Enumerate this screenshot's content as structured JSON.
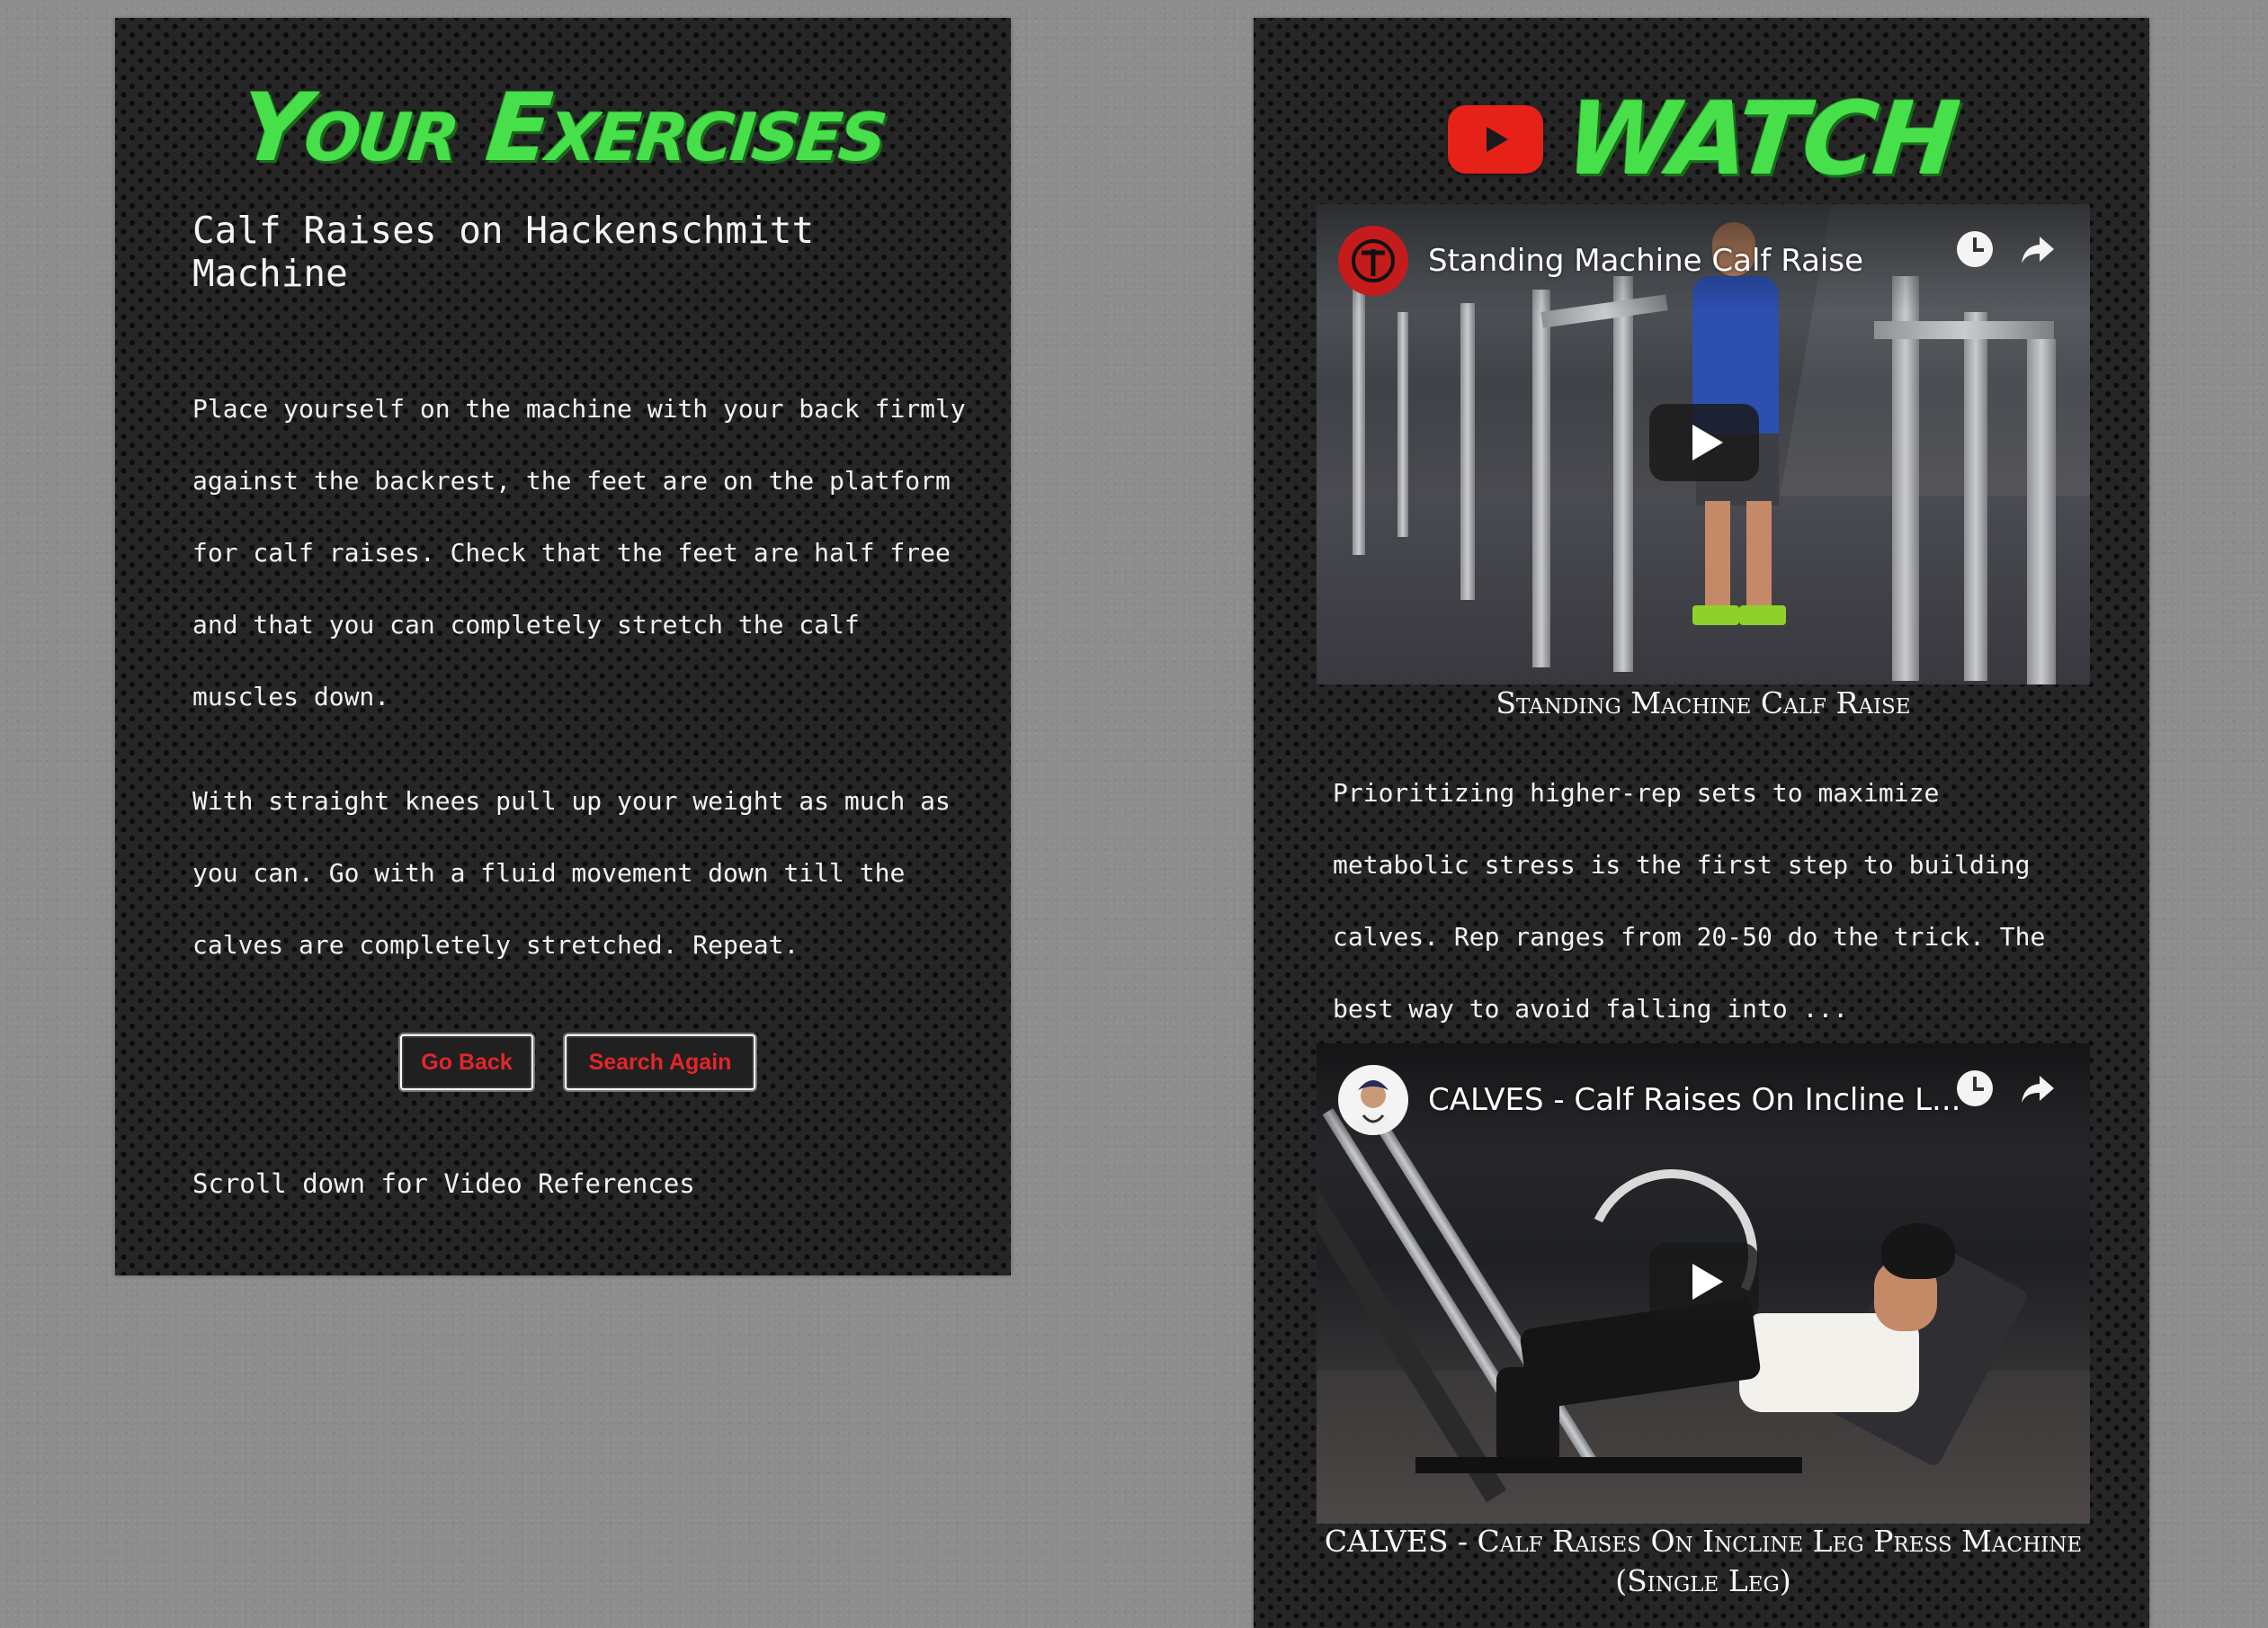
{
  "colors": {
    "title_green": "#47e04a",
    "button_text_red": "#e3262a",
    "youtube_red": "#e62117",
    "panel_background": "#262626"
  },
  "left": {
    "title": "Your Exercises",
    "exercise_name": "Calf Raises on Hackenschmitt Machine",
    "paragraphs": [
      "Place yourself on the machine with your back firmly against the backrest, the feet are on the platform for calf raises. Check that the feet are half free and that you can completely stretch the calf muscles down.",
      "With straight knees pull up your weight as much as you can. Go with a fluid movement down till the calves are completely stretched. Repeat."
    ],
    "buttons": {
      "go_back": "Go Back",
      "search_again": "Search Again"
    },
    "scroll_note": "Scroll down for Video References"
  },
  "right": {
    "title": "Watch",
    "icons": {
      "logo": "youtube-logo-icon",
      "clock": "watch-later-clock-icon",
      "share": "share-arrow-icon",
      "play": "play-icon"
    },
    "videos": [
      {
        "player_title": "Standing Machine Calf Raise",
        "caption": "Standing Machine Calf Raise",
        "description": "Prioritizing higher-rep sets to maximize metabolic stress is the first step to building calves. Rep ranges from 20-50 do the trick. The best way to avoid falling into ..."
      },
      {
        "player_title": "CALVES - Calf Raises On Incline L...",
        "caption": "CALVES - Calf Raises On Incline Leg Press Machine (Single Leg)"
      }
    ]
  }
}
